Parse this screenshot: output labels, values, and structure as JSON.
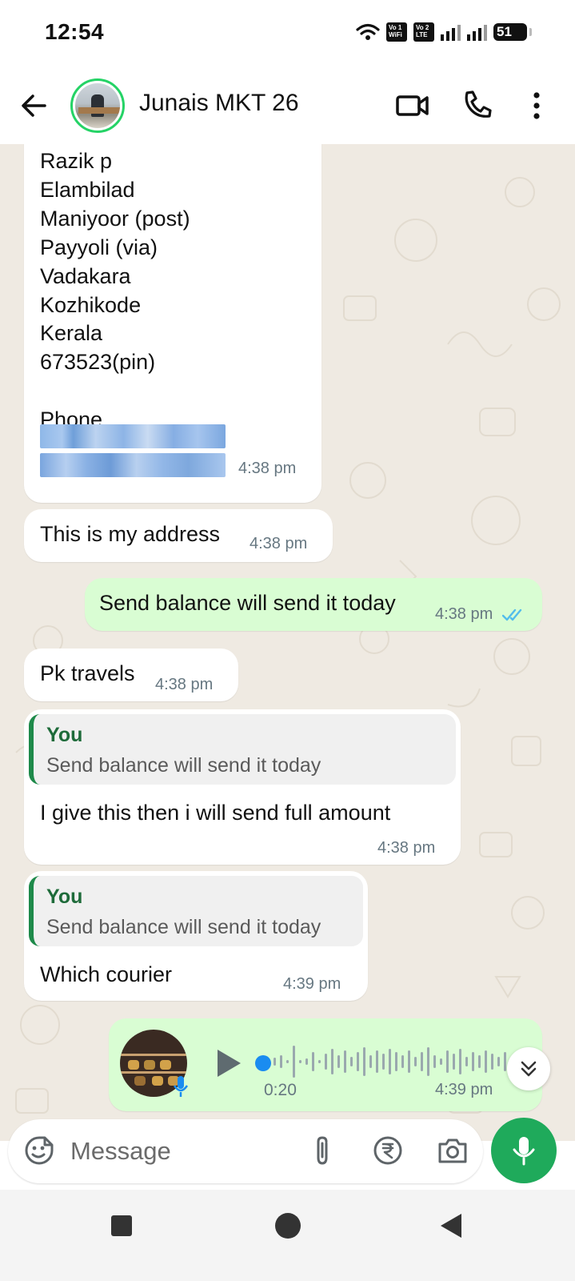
{
  "status_bar": {
    "time": "12:54",
    "sim1_label": "Vo 1 WiFi",
    "sim2_label": "Vo 2 LTE",
    "battery": "51"
  },
  "header": {
    "contact_name": "Junais MKT 26",
    "icons": [
      "back-arrow-icon",
      "video-call-icon",
      "voice-call-icon",
      "more-options-icon"
    ]
  },
  "messages": {
    "address": {
      "lines": [
        "Razik p",
        "Elambilad",
        "Maniyoor (post)",
        "Payyoli (via)",
        "Vadakara",
        "Kozhikode",
        "Kerala",
        "673523(pin)",
        "",
        "Phone"
      ],
      "time": "4:38 pm"
    },
    "m2": {
      "text": "This is my address",
      "time": "4:38 pm"
    },
    "m3": {
      "text": "Send balance will send it today",
      "time": "4:38 pm",
      "status": "read"
    },
    "m4": {
      "text": "Pk travels",
      "time": "4:38 pm"
    },
    "m5": {
      "quote_author": "You",
      "quote_text": "Send balance will send it today",
      "text": "I give this then  i will send full amount",
      "time": "4:38 pm"
    },
    "m6": {
      "quote_author": "You",
      "quote_text": "Send balance will send it today",
      "text": "Which courier",
      "time": "4:39 pm"
    },
    "voice_note": {
      "duration": "0:20",
      "time": "4:39 pm"
    }
  },
  "composer": {
    "placeholder": "Message",
    "icons": [
      "emoji-icon",
      "attach-icon",
      "rupee-icon",
      "camera-icon",
      "mic-icon"
    ]
  },
  "colors": {
    "chat_background": "#efeae2",
    "outgoing_bubble": "#d9fdd3",
    "accent_green": "#1faa5b",
    "read_ticks": "#53bdeb"
  }
}
